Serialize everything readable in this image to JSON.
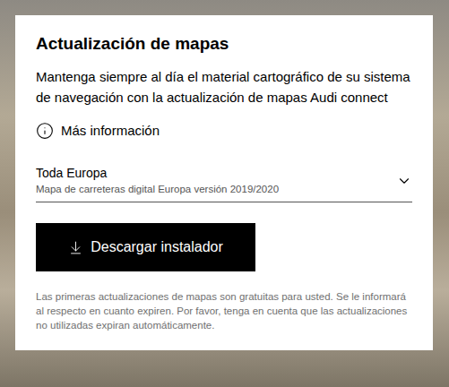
{
  "card": {
    "title": "Actualización de mapas",
    "description": "Mantenga siempre al día el material cartográfico de su sistema de navegación con la actualización de mapas Audi connect",
    "info_link": {
      "label": "Más información"
    },
    "region_select": {
      "value": "Toda Europa",
      "subtitle": "Mapa de carreteras digital Europa versión 2019/2020",
      "expanded": false
    },
    "download_button": {
      "label": "Descargar instalador"
    },
    "footnote": "Las primeras actualizaciones de mapas son gratuitas para usted. Se le informará al respecto en cuanto expiren. Por favor, tenga en cuenta que las actualizaciones no utilizadas expiran automáticamente."
  }
}
